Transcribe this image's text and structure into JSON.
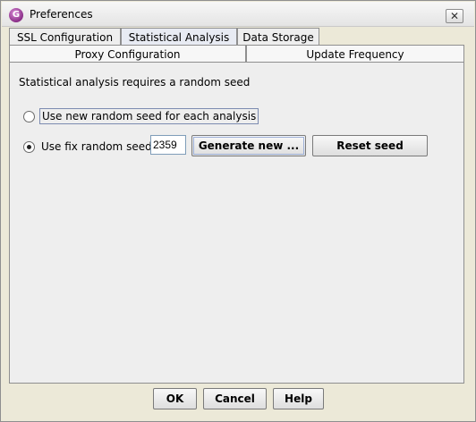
{
  "window": {
    "title": "Preferences",
    "close_glyph": "✕",
    "app_icon_letter": "G"
  },
  "tabs_row1": [
    {
      "label": "SSL Configuration",
      "active": false
    },
    {
      "label": "Statistical Analysis",
      "active": true
    },
    {
      "label": "Data Storage",
      "active": false
    }
  ],
  "tabs_row2": [
    {
      "label": "Proxy Configuration"
    },
    {
      "label": "Update Frequency"
    }
  ],
  "panel": {
    "heading": "Statistical analysis requires a random seed",
    "option_new": {
      "label": "Use new random seed for each analysis",
      "checked": false
    },
    "option_fix": {
      "label": "Use fix random seed",
      "checked": true
    },
    "seed_value": "2359",
    "generate_label": "Generate new ...",
    "reset_label": "Reset seed"
  },
  "footer": {
    "ok_label": "OK",
    "cancel_label": "Cancel",
    "help_label": "Help"
  },
  "icons": {
    "app": "app-logo-icon",
    "close": "close-icon"
  }
}
